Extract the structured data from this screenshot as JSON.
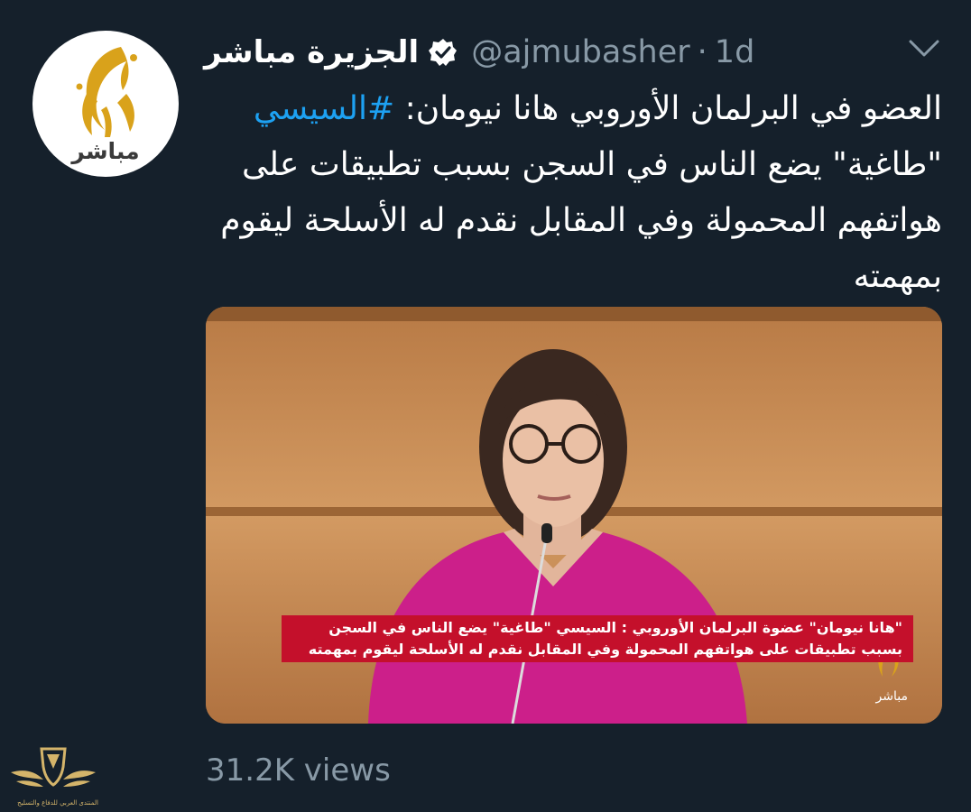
{
  "tweet": {
    "avatar_label": "مباشر",
    "display_name": "الجزيرة مباشر",
    "handle": "@ajmubasher",
    "separator": "·",
    "time": "1d",
    "text_lead": "العضو في البرلمان الأوروبي هانا نيومان: ",
    "hashtag": "#السيسي",
    "text_body": "\"طاغية\" يضع الناس في السجن بسبب تطبيقات على هواتفهم المحمولة وفي المقابل نقدم له الأسلحة ليقوم بمهمته",
    "views": "31.2K views"
  },
  "media": {
    "caption": "\"هانا نيومان\" عضوة البرلمان الأوروبي : السيسي \"طاغية\" يضع الناس في السجن بسبب تطبيقات على هواتفهم المحمولة وفي المقابل نقدم له الأسلحة ليقوم بمهمته",
    "logo_label": "مباشر"
  },
  "watermark": {
    "text": "المنتدى العربي للدفاع والتسليح"
  },
  "colors": {
    "background": "#15202b",
    "secondary_text": "#8899a6",
    "hashtag": "#1da1f2",
    "verified": "#ffffff",
    "caption_bar": "#c4102b",
    "logo_gold": "#d9a21b"
  },
  "icons": {
    "verified": "verified-badge-icon",
    "more": "chevron-down-icon",
    "avatar_logo": "aljazeera-logo",
    "watermark": "shield-wings-logo"
  }
}
